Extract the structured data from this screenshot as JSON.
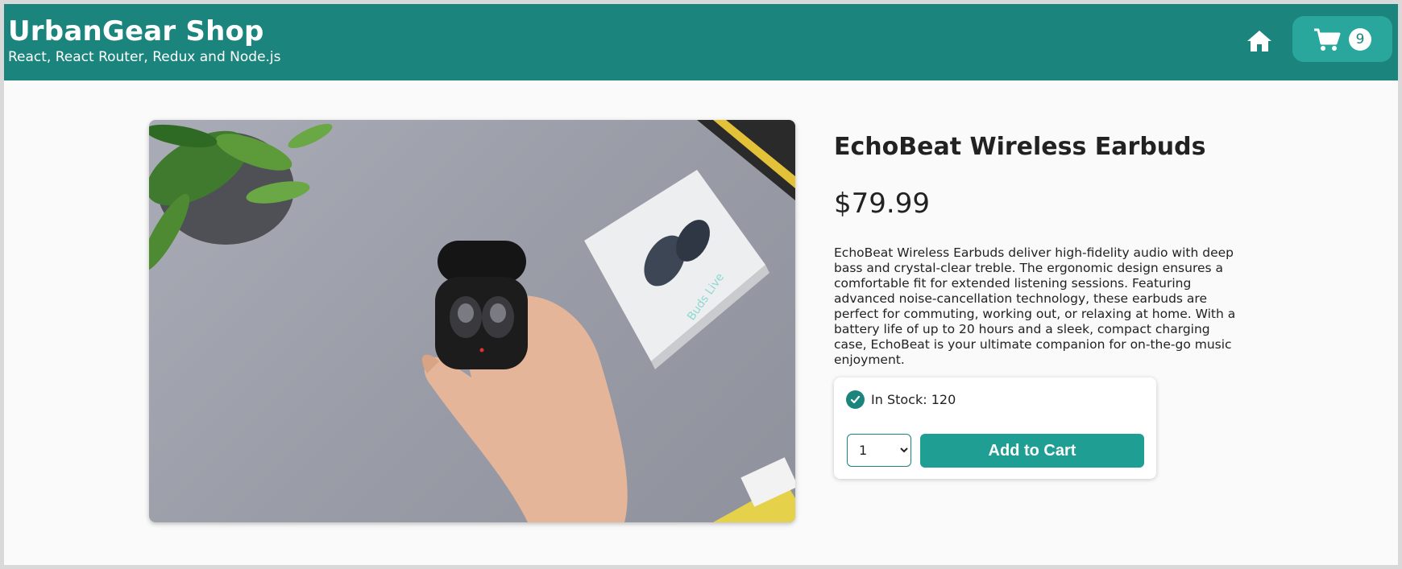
{
  "header": {
    "title": "UrbanGear Shop",
    "subtitle": "React, React Router, Redux and Node.js",
    "home_icon": "home-icon",
    "cart_icon": "cart-icon",
    "cart_count": "9"
  },
  "product": {
    "name": "EchoBeat Wireless Earbuds",
    "price": "$79.99",
    "description": "EchoBeat Wireless Earbuds deliver high-fidelity audio with deep bass and crystal-clear treble. The ergonomic design ensures a comfortable fit for extended listening sessions. Featuring advanced noise-cancellation technology, these earbuds are perfect for commuting, working out, or relaxing at home. With a battery life of up to 20 hours and a sleek, compact charging case, EchoBeat is your ultimate companion for on-the-go music enjoyment.",
    "image_icon": "product-photo",
    "case_print": "Buds Live"
  },
  "purchase": {
    "stock_label": "In Stock: 120",
    "stock_icon": "check-circle-icon",
    "quantity_selected": "1",
    "add_to_cart_label": "Add to Cart"
  },
  "colors": {
    "brand": "#1b857d",
    "cart_button": "#2aa79c",
    "add_button": "#1f9e93"
  }
}
